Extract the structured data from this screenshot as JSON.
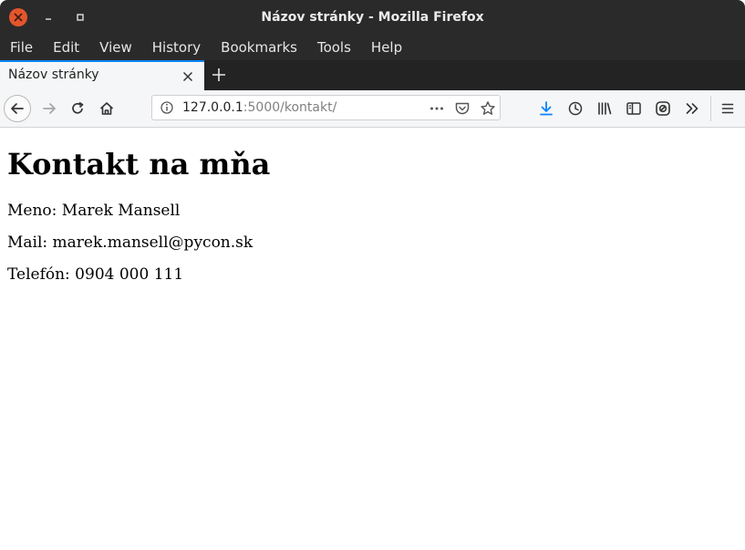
{
  "window": {
    "title": "Názov stránky - Mozilla Firefox"
  },
  "menubar": {
    "items": [
      "File",
      "Edit",
      "View",
      "History",
      "Bookmarks",
      "Tools",
      "Help"
    ]
  },
  "tabs": [
    {
      "label": "Názov stránky",
      "active": true
    }
  ],
  "urlbar": {
    "host": "127.0.0.1",
    "rest": ":5000/kontakt/"
  },
  "icons": {
    "close_window": "close-icon",
    "minimize": "minimize-icon",
    "maximize": "maximize-icon",
    "back": "back-arrow-icon",
    "forward": "forward-arrow-icon",
    "reload": "reload-icon",
    "home": "home-icon",
    "info": "info-icon",
    "page_actions": "ellipsis-icon",
    "pocket": "pocket-icon",
    "bookmark": "star-icon",
    "downloads": "download-icon",
    "history": "clock-icon",
    "library": "library-icon",
    "sidebar": "sidebar-icon",
    "sync": "sync-icon",
    "overflow": "chevron-double-right-icon",
    "menu": "hamburger-menu-icon"
  },
  "colors": {
    "titlebar_bg": "#2b2a2a",
    "close_button": "#e4552c",
    "accent_blue": "#0a84ff",
    "toolbar_bg": "#f5f6f7"
  },
  "page": {
    "heading": "Kontakt na mňa",
    "name_line": "Meno: Marek Mansell",
    "mail_line": "Mail: marek.mansell@pycon.sk",
    "phone_line": "Telefón: 0904 000 111"
  }
}
